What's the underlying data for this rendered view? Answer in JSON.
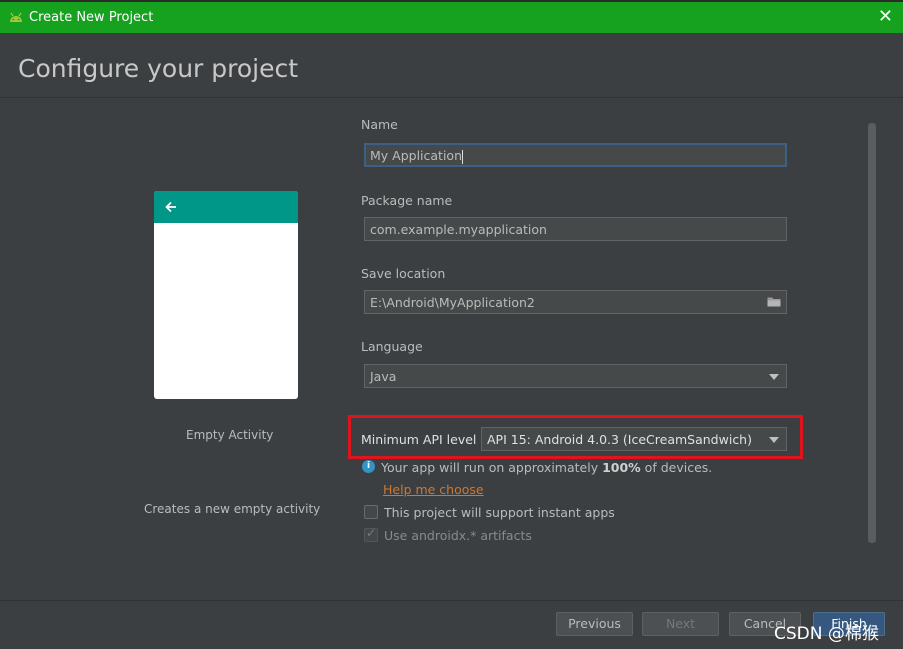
{
  "window": {
    "title": "Create New Project",
    "close_glyph": "✕"
  },
  "page": {
    "heading": "Configure your project"
  },
  "template": {
    "name": "Empty Activity",
    "description": "Creates a new empty activity",
    "back_glyph": "🡐"
  },
  "form": {
    "name": {
      "label": "Name",
      "value": "My Application"
    },
    "package": {
      "label": "Package name",
      "value": "com.example.myapplication"
    },
    "save_location": {
      "label": "Save location",
      "value": "E:\\Android\\MyApplication2",
      "icon": "folder-icon"
    },
    "language": {
      "label": "Language",
      "value": "Java"
    },
    "min_api": {
      "label": "Minimum API level",
      "value": "API 15: Android 4.0.3 (IceCreamSandwich)"
    },
    "info": {
      "prefix": "Your app will run on approximately ",
      "percent": "100%",
      "suffix": " of devices."
    },
    "help_link": "Help me choose",
    "instant_apps": {
      "label": "This project will support instant apps",
      "checked": false
    },
    "androidx": {
      "label": "Use androidx.* artifacts",
      "checked": true
    }
  },
  "buttons": {
    "previous": "Previous",
    "next": "Next",
    "cancel": "Cancel",
    "finish": "Finish"
  },
  "watermark": "CSDN @棉猴",
  "colors": {
    "titlebar": "#16a21f",
    "highlight": "#e0141e",
    "preview_bar": "#009688",
    "link": "#cc7832"
  }
}
